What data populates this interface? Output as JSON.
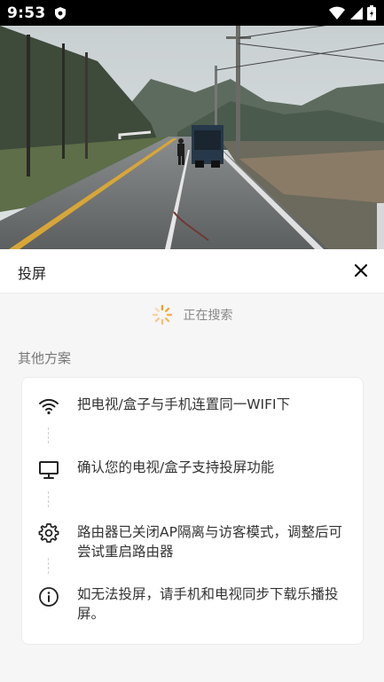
{
  "status_bar": {
    "time": "9:53"
  },
  "sheet": {
    "title": "投屏",
    "searching_text": "正在搜索",
    "other_solutions_title": "其他方案",
    "tips": [
      {
        "icon": "wifi-icon",
        "text": "把电视/盒子与手机连置同一WIFI下"
      },
      {
        "icon": "monitor-icon",
        "text": "确认您的电视/盒子支持投屏功能"
      },
      {
        "icon": "gear-icon",
        "text_line1": "路由器已关闭AP隔离与访客模式，调整后可",
        "text_line2": "尝试重启路由器"
      },
      {
        "icon": "info-icon",
        "text": "如无法投屏，请手机和电视同步下载乐播投屏。"
      }
    ]
  },
  "colors": {
    "background": "#f6f6f6",
    "card": "#ffffff",
    "text": "#333333",
    "muted": "#888888"
  }
}
